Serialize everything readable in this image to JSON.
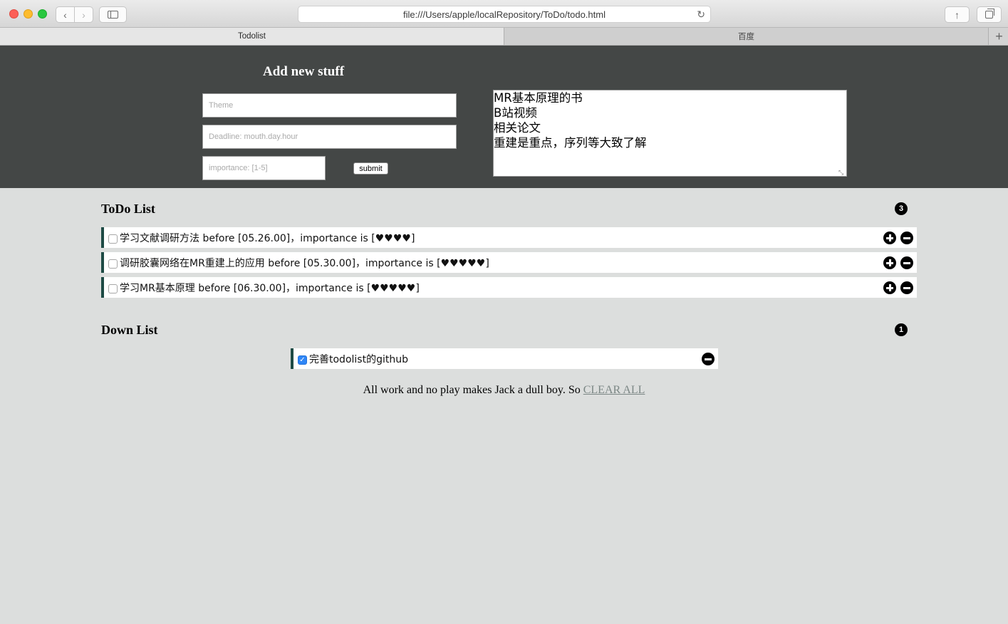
{
  "browser": {
    "url": "file:///Users/apple/localRepository/ToDo/todo.html",
    "tabs": [
      {
        "label": "Todolist",
        "active": true
      },
      {
        "label": "百度",
        "active": false
      }
    ]
  },
  "form": {
    "title": "Add new stuff",
    "theme_placeholder": "Theme",
    "deadline_placeholder": "Deadline: mouth.day.hour",
    "importance_placeholder": "importance: [1-5]",
    "submit_label": "submit",
    "notes_value": "MR基本原理的书\nB站视频\n相关论文\n重建是重点，序列等大致了解"
  },
  "todo": {
    "title": "ToDo List",
    "count": "3",
    "items": [
      {
        "text": "学习文献调研方法 before [05.26.00]，importance is [♥♥♥♥]",
        "checked": false
      },
      {
        "text": "调研胶囊网络在MR重建上的应用 before [05.30.00]，importance is [♥♥♥♥♥]",
        "checked": false
      },
      {
        "text": "学习MR基本原理 before [06.30.00]，importance is [♥♥♥♥♥]",
        "checked": false
      }
    ]
  },
  "done": {
    "title": "Down List",
    "count": "1",
    "items": [
      {
        "text": "完善todolist的github",
        "checked": true
      }
    ]
  },
  "footer": {
    "text": "All work and no play makes Jack a dull boy. So ",
    "link_label": "CLEAR ALL"
  },
  "colors": {
    "header_bg": "#444746",
    "page_bg": "#dcdedd",
    "item_accent": "#1e4b45",
    "link": "#7c8785"
  }
}
